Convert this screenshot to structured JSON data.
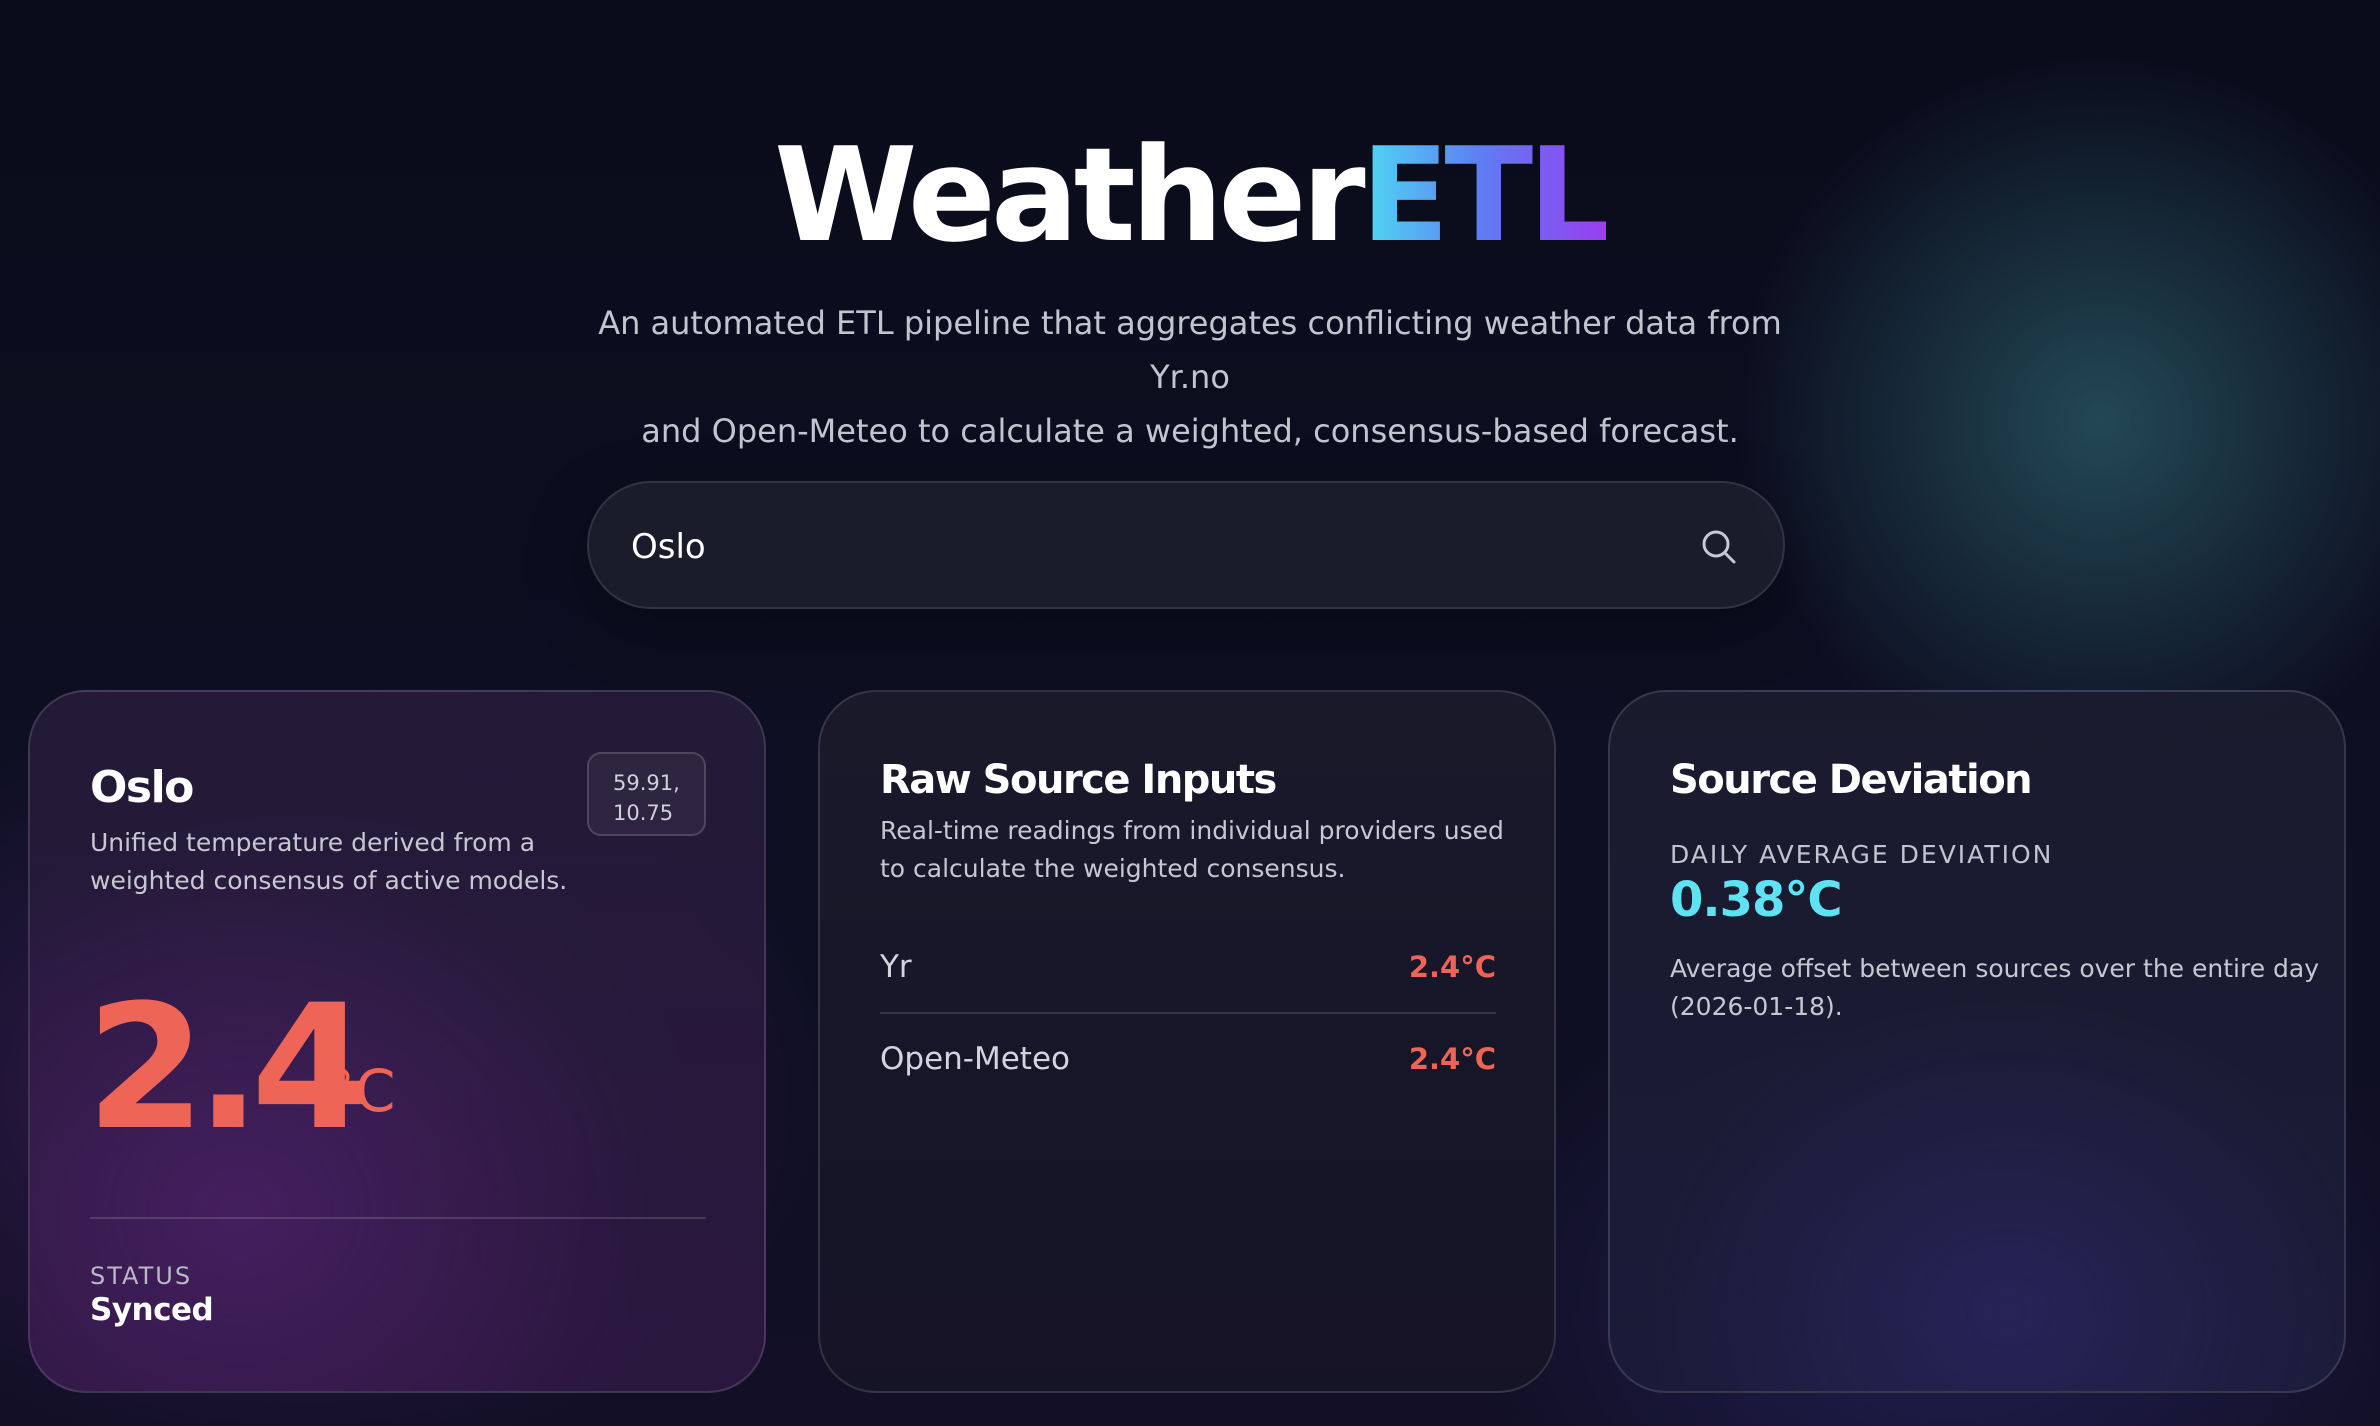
{
  "header": {
    "title_main": "Weather",
    "title_accent": "ETL",
    "subtitle_line1": "An automated ETL pipeline that aggregates conflicting weather data from Yr.no",
    "subtitle_line2": "and Open-Meteo to calculate a weighted, consensus-based forecast."
  },
  "search": {
    "value": "Oslo",
    "icon": "search-icon"
  },
  "location_card": {
    "city": "Oslo",
    "coords_line1": "59.91,",
    "coords_line2": "10.75",
    "desc_line1": "Unified temperature derived from a",
    "desc_line2": "weighted consensus of active models.",
    "temperature": "2.4",
    "unit": "°C",
    "status_label": "STATUS",
    "status_value": "Synced",
    "accent_color": "#ee6557"
  },
  "sources_card": {
    "title": "Raw Source Inputs",
    "desc_line1": "Real-time readings from individual providers used",
    "desc_line2": "to calculate the weighted consensus.",
    "sources": [
      {
        "name": "Yr",
        "value": "2.4°C"
      },
      {
        "name": "Open-Meteo",
        "value": "2.4°C"
      }
    ]
  },
  "deviation_card": {
    "title": "Source Deviation",
    "label": "DAILY AVERAGE DEVIATION",
    "value": "0.38°C",
    "desc_line1": "Average offset between sources over the entire day",
    "desc_line2": "(2026-01-18).",
    "accent_color": "#5fe3f2"
  }
}
